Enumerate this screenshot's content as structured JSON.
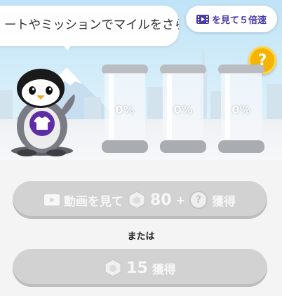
{
  "speech_bubble": {
    "text": "ートやミッションでマイルをさらに"
  },
  "boost_button": {
    "label": "を見て５倍速",
    "icon": "video-play-icon"
  },
  "help_badge": {
    "label": "?"
  },
  "capsules": [
    {
      "percent": "0%"
    },
    {
      "percent": "0%"
    },
    {
      "percent": "0%"
    }
  ],
  "mascot": {
    "name": "penguin",
    "shirt_icon": "tshirt-icon"
  },
  "watch_video_button": {
    "label": "動画を見て",
    "amount": "80",
    "plus": "+",
    "mystery": "?",
    "suffix": "獲得",
    "icons": [
      "video-play-icon",
      "gem-icon",
      "mystery-coin-icon"
    ]
  },
  "or_text": "または",
  "direct_button": {
    "amount": "15",
    "suffix": "獲得",
    "icon": "gem-icon"
  },
  "colors": {
    "accent": "#4a3aa8",
    "badge": "#f4b400",
    "disabled": "#d2d2d2"
  }
}
